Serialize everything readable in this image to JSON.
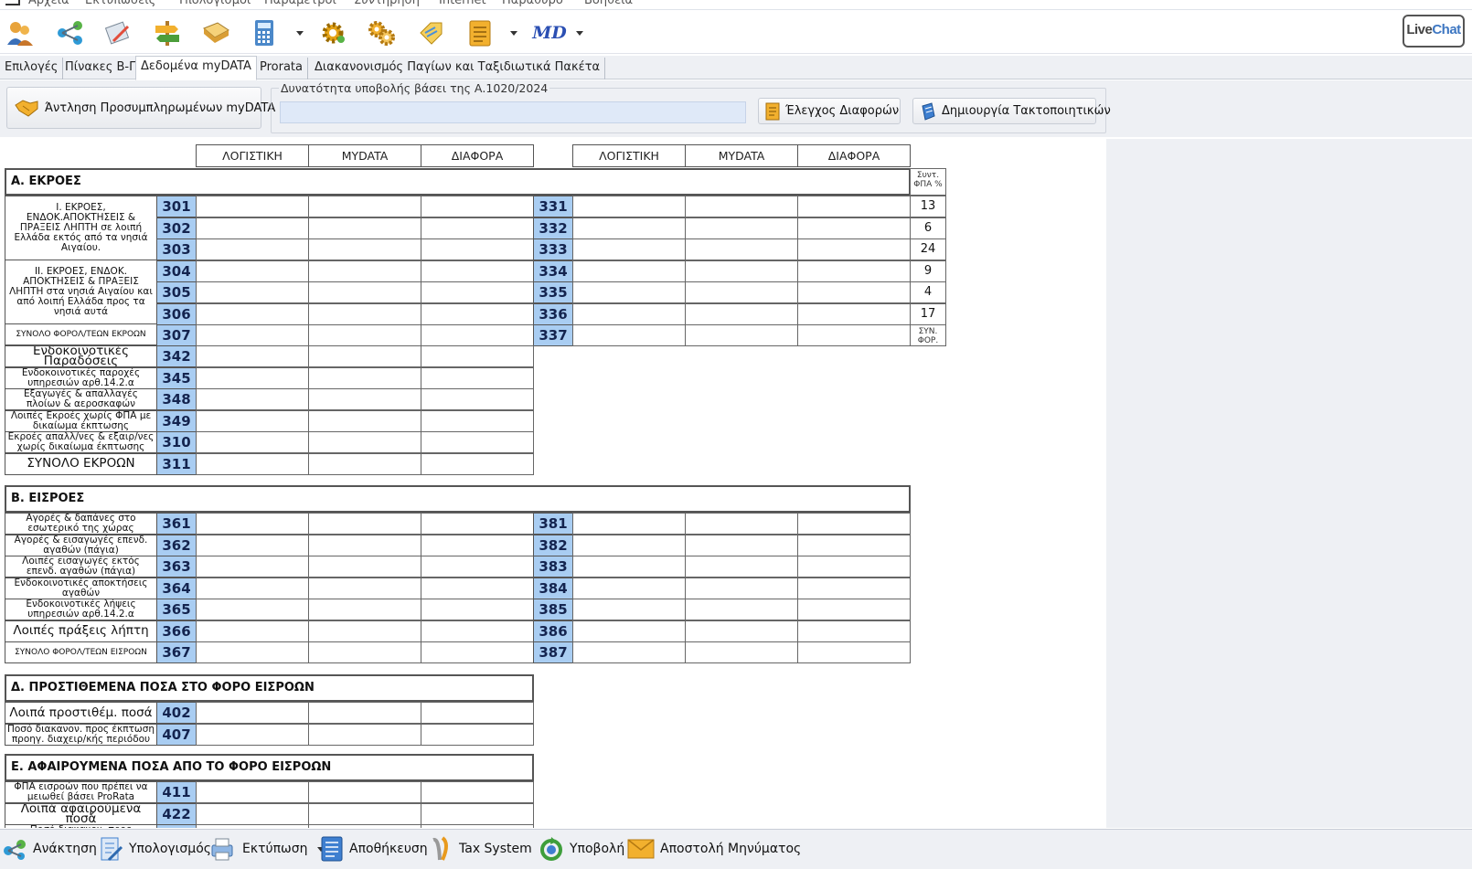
{
  "menu": [
    "Αρχεία",
    "Εκτυπώσεις",
    "Υπολογισμοί",
    "Παράμετροι",
    "Συντήρηση",
    "Internet",
    "Παράθυρο",
    "Βοήθεια"
  ],
  "toolbar": {
    "icons": [
      "users-icon",
      "share-icon",
      "edit-document-icon",
      "signpost-icon",
      "book-icon",
      "calculator-icon",
      "gear-icon",
      "gears-icon",
      "tag-icon",
      "notes-icon",
      "md-icon"
    ],
    "md_label": "MD",
    "livechat_a": "Live",
    "livechat_b": "Chat"
  },
  "tabs": [
    "Επιλογές",
    "Πίνακες Β-Γ",
    "Δεδομένα myDATA",
    "Prorata",
    "Διακανονισμός Παγίων και Ταξιδιωτικά Πακέτα"
  ],
  "controls": {
    "fetch_button": "Άντληση Προσυμπληρωμένων myDATA",
    "group_label": "Δυνατότητα υποβολής βάσει της Α.1020/2024",
    "group_value": "",
    "diff_button": "Έλεγχος Διαφορών",
    "create_button": "Δημιουργία Τακτοποιητικών"
  },
  "columns": [
    "ΛΟΓΙΣΤΙΚΗ",
    "MYDATA",
    "ΔΙΑΦΟΡΑ"
  ],
  "sections": {
    "a_title": "Α. ΕΚΡΟΕΣ",
    "b_title": "Β. ΕΙΣΡΟΕΣ",
    "d_title": "Δ. ΠΡΟΣΤΙΘΕΜΕΝΑ ΠΟΣΑ ΣΤΟ ΦΟΡΟ ΕΙΣΡΟΩΝ",
    "e_title": "Ε. ΑΦΑΙΡΟΥΜΕΝΑ ΠΟΣΑ ΑΠΟ ΤΟ ΦΟΡΟ ΕΙΣΡΟΩΝ"
  },
  "rate_header": "Συντ. ΦΠΑ %",
  "a_group1_label": "Ι. ΕΚΡΟΕΣ, ΕΝΔΟΚ.ΑΠΟΚΤΗΣΕΙΣ & ΠΡΑΞΕΙΣ ΛΗΠΤΗ σε λοιπή Ελλάδα εκτός από τα νησιά Αιγαίου.",
  "a_group2_label": "ΙΙ. ΕΚΡΟΕΣ, ΕΝΔΟΚ. ΑΠΟΚΤΗΣΕΙΣ & ΠΡΑΞΕΙΣ ΛΗΠΤΗ στα νησιά Αιγαίου και από λοιπή Ελλάδα προς τα νησιά αυτά",
  "a_rows": [
    {
      "code": "301",
      "code2": "331",
      "rate": "13"
    },
    {
      "code": "302",
      "code2": "332",
      "rate": "6"
    },
    {
      "code": "303",
      "code2": "333",
      "rate": "24"
    },
    {
      "code": "304",
      "code2": "334",
      "rate": "9"
    },
    {
      "code": "305",
      "code2": "335",
      "rate": "4"
    },
    {
      "code": "306",
      "code2": "336",
      "rate": "17"
    },
    {
      "label": "ΣΥΝΟΛΟ ΦΟΡΟΛ/ΤΕΩΝ ΕΚΡΟΩΝ",
      "code": "307",
      "code2": "337",
      "rate": "ΣΥΝ. ΦΟΡ."
    }
  ],
  "a_extra_rows": [
    {
      "label": "Ενδοκοινοτικές Παραδόσεις",
      "code": "342"
    },
    {
      "label": "Ενδοκοινοτικές παροχές υπηρεσιών αρθ.14.2.α",
      "code": "345"
    },
    {
      "label": "Εξαγωγές & απαλλαγές πλοίων & αεροσκαφών",
      "code": "348"
    },
    {
      "label": "Λοιπές Εκροές χωρίς ΦΠΑ με δικαίωμα έκπτωσης",
      "code": "349"
    },
    {
      "label": "Εκροές απαλλ/νες & εξαιρ/νες χωρίς δικαίωμα έκπτωσης",
      "code": "310"
    },
    {
      "label": "ΣΥΝΟΛΟ ΕΚΡΟΩΝ",
      "code": "311"
    }
  ],
  "b_rows": [
    {
      "label": "Αγορές & δαπάνες στο εσωτερικό της χώρας",
      "code": "361",
      "code2": "381"
    },
    {
      "label": "Αγορές & εισαγωγές επενδ. αγαθών (πάγια)",
      "code": "362",
      "code2": "382"
    },
    {
      "label": "Λοιπές εισαγωγές εκτός επενδ. αγαθών (πάγια)",
      "code": "363",
      "code2": "383"
    },
    {
      "label": "Ενδοκοινοτικές αποκτήσεις αγαθών",
      "code": "364",
      "code2": "384"
    },
    {
      "label": "Ενδοκοινοτικές λήψεις υπηρεσιών αρθ.14.2.α",
      "code": "365",
      "code2": "385"
    },
    {
      "label": "Λοιπές πράξεις λήπτη",
      "code": "366",
      "code2": "386"
    },
    {
      "label": "ΣΥΝΟΛΟ ΦΟΡΟΛ/ΤΕΩΝ ΕΙΣΡΟΩΝ",
      "code": "367",
      "code2": "387"
    }
  ],
  "d_rows": [
    {
      "label": "Λοιπά προστιθέμ. ποσά",
      "code": "402"
    },
    {
      "label": "Ποσό διακανον. προς έκπτωση προηγ. διαχειρ/κής περιόδου",
      "code": "407"
    }
  ],
  "e_rows": [
    {
      "label": "ΦΠΑ εισροών που πρέπει να μειωθεί βάσει ProRata",
      "code": "411"
    },
    {
      "label": "Λοιπά αφαιρούμενα ποσά",
      "code": "422"
    },
    {
      "label": "Ποσό διακανον. προς καταβολή",
      "code": ""
    }
  ],
  "bottom": [
    "Ανάκτηση",
    "Υπολογισμός",
    "Εκτύπωση",
    "Αποθήκευση",
    "Tax System",
    "Υποβολή",
    "Αποστολή Μηνύματος"
  ]
}
